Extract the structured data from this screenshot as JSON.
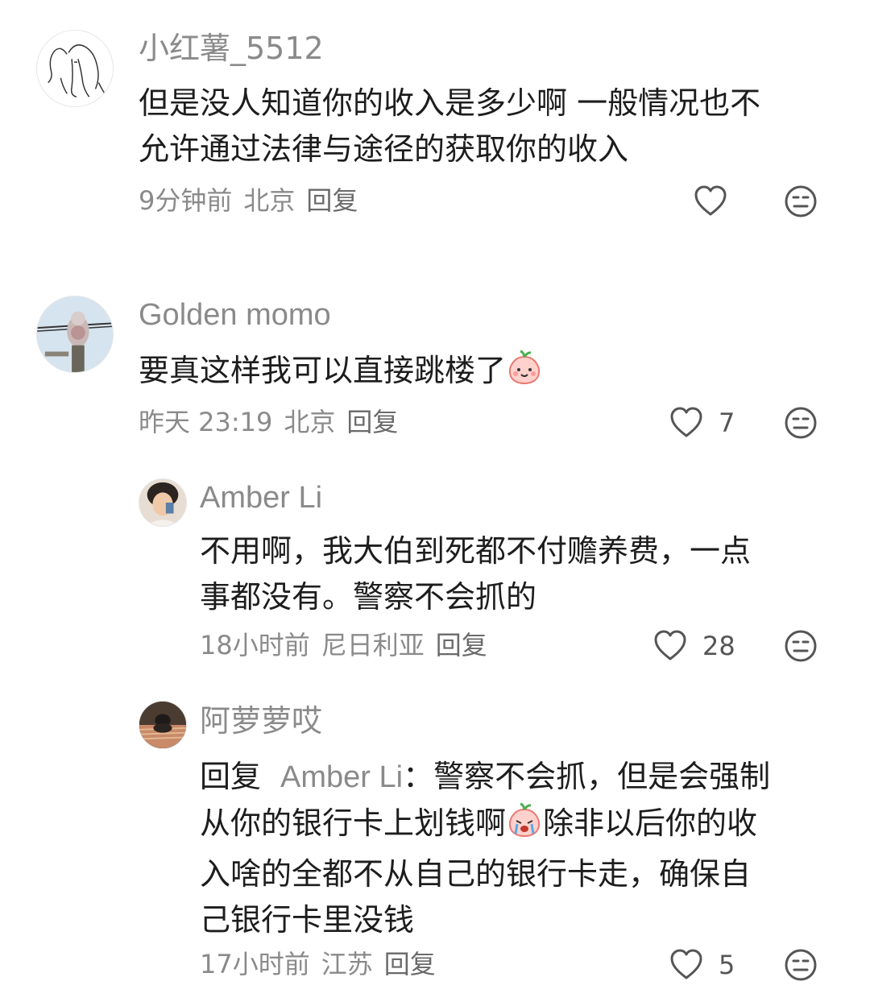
{
  "comments": [
    {
      "username": "小红薯_5512",
      "text_line1": "但是没人知道你的收入是多少啊 一般情况也不",
      "text_line2": "允许通过法律与途径的获取你的收入",
      "time": "9分钟前",
      "location": "北京",
      "reply": "回复",
      "likes": "",
      "avatar_icon": "elephant-sketch-avatar"
    },
    {
      "username": "Golden momo",
      "text": "要真这样我可以直接跳楼了",
      "emoji_icon": "peach-smile-emoji",
      "time": "昨天 23:19",
      "location": "北京",
      "reply": "回复",
      "likes": "7",
      "avatar_icon": "owl-photo-avatar"
    }
  ],
  "replies": [
    {
      "username": "Amber Li",
      "text_line1": "不用啊，我大伯到死都不付赡养费，一点",
      "text_line2": "事都没有。警察不会抓的",
      "time": "18小时前",
      "location": "尼日利亚",
      "reply": "回复",
      "likes": "28"
    },
    {
      "username": "阿萝萝哎",
      "reply_prefix": "回复",
      "reply_to": "Amber Li",
      "line1_rest": "：警察不会抓，但是会强制",
      "line2_a": "从你的银行卡上划钱啊",
      "line2_b": "除非以后你的收",
      "line3": "入啥的全都不从自己的银行卡走，确保自",
      "line4": "己银行卡里没钱",
      "emoji_icon": "peach-crying-emoji",
      "time": "17小时前",
      "location": "江苏",
      "reply": "回复",
      "likes": "5"
    }
  ],
  "colors": {
    "text": "#1d1d1d",
    "muted": "#8a8a8a",
    "icon": "#555555"
  }
}
